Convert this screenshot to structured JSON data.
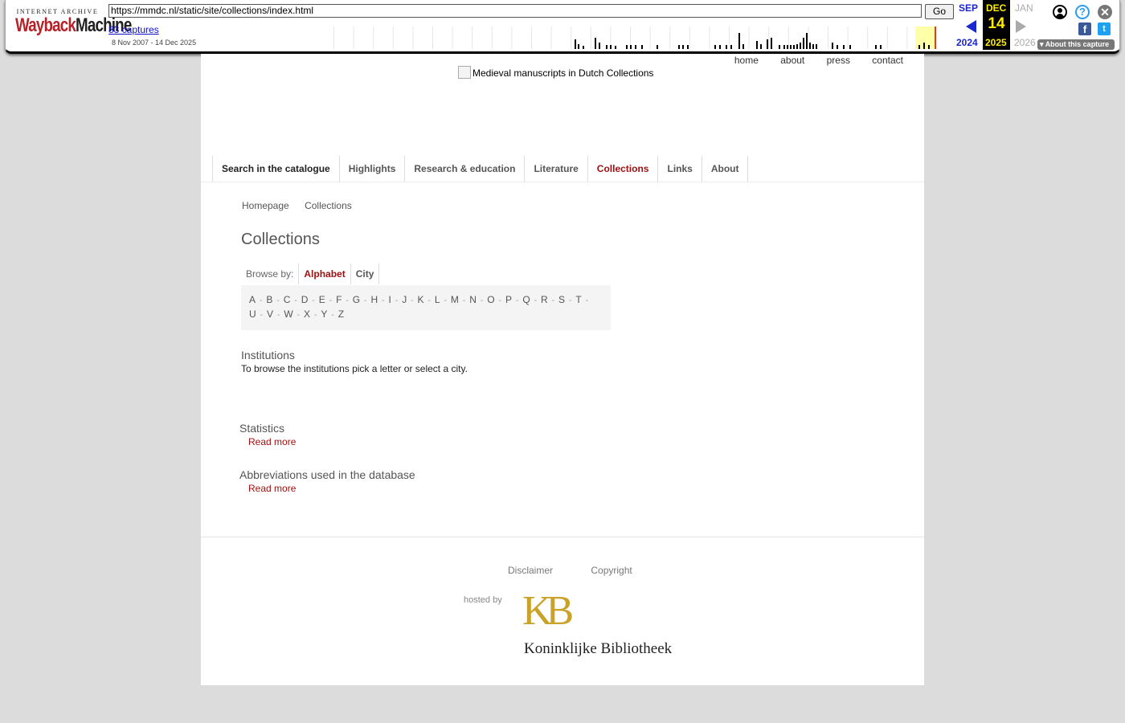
{
  "wayback": {
    "logo_top": "INTERNET ARCHIVE",
    "logo_way": "Wayback",
    "logo_machine": "Machine",
    "url": "https://mmdc.nl/static/site/collections/index.html",
    "go_label": "Go",
    "captures": "83 captures",
    "range": "8 Nov 2007 - 14 Dec 2025",
    "month_prev": "SEP",
    "month_cur": "DEC",
    "month_next": "JAN",
    "day": "14",
    "year_prev": "2024",
    "year_cur": "2025",
    "year_next": "2026",
    "about_capture": "About this capture",
    "icons": [
      "user-icon",
      "help-icon",
      "close-icon",
      "facebook-icon",
      "twitter-icon"
    ]
  },
  "top_nav": [
    "home",
    "about",
    "press",
    "contact"
  ],
  "logo_alt": "Medieval manuscripts in Dutch Collections",
  "main_nav": [
    {
      "label": "Search in the catalogue"
    },
    {
      "label": "Highlights"
    },
    {
      "label": "Research & education"
    },
    {
      "label": "Literature"
    },
    {
      "label": "Collections"
    },
    {
      "label": "Links"
    },
    {
      "label": "About"
    }
  ],
  "active_nav": "Collections",
  "breadcrumb": [
    "Homepage",
    "Collections"
  ],
  "page_title": "Collections",
  "browse": {
    "label": "Browse by:",
    "options": [
      "Alphabet",
      "City"
    ],
    "active": "Alphabet"
  },
  "letters_row1": [
    "A",
    "B",
    "C",
    "D",
    "E",
    "F",
    "G",
    "H",
    "I",
    "J",
    "K",
    "L",
    "M",
    "N",
    "O",
    "P",
    "Q",
    "R",
    "S",
    "T"
  ],
  "letters_row2": [
    "U",
    "V",
    "W",
    "X",
    "Y",
    "Z"
  ],
  "institutions": {
    "heading": "Institutions",
    "text": "To browse the institutions pick a letter or select a city."
  },
  "statistics": {
    "heading": "Statistics",
    "link": "Read more"
  },
  "abbreviations": {
    "heading": "Abbreviations used in the database",
    "link": "Read more"
  },
  "footer": {
    "links": [
      "Disclaimer",
      "Copyright"
    ],
    "hosted_by": "hosted by",
    "kb_mark": "KB",
    "kb_name": "Koninklijke Bibliotheek"
  },
  "colors": {
    "accent": "#a01010",
    "page_bg": "#dcdcdc",
    "kb_gold": "#c9a227",
    "wayback_red": "#b52127",
    "wayback_blue": "#1a27cc"
  }
}
